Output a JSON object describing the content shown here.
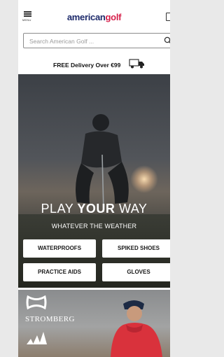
{
  "header": {
    "menu_label": "MENU",
    "logo_part1": "american",
    "logo_part2": "golf",
    "icons": {
      "menu": "hamburger-icon",
      "bag": "shopping-bag-icon"
    }
  },
  "search": {
    "placeholder": "Search American Golf ...",
    "icon": "search-icon"
  },
  "delivery": {
    "text": "FREE Delivery Over €99",
    "icon": "delivery-truck-icon"
  },
  "hero": {
    "title_thin1": "PLAY ",
    "title_bold": "YOUR",
    "title_thin2": " WAY",
    "subtitle": "WHATEVER THE WEATHER",
    "buttons": [
      "WATERPROOFS",
      "SPIKED SHOES",
      "PRACTICE AIDS",
      "GLOVES"
    ]
  },
  "brands": {
    "brand2": "STROMBERG",
    "icons": [
      "under-armour-logo",
      "adidas-logo"
    ]
  },
  "colors": {
    "logo_navy": "#1d2a6b",
    "logo_red": "#d6204b",
    "background": "#e9e9e9"
  }
}
